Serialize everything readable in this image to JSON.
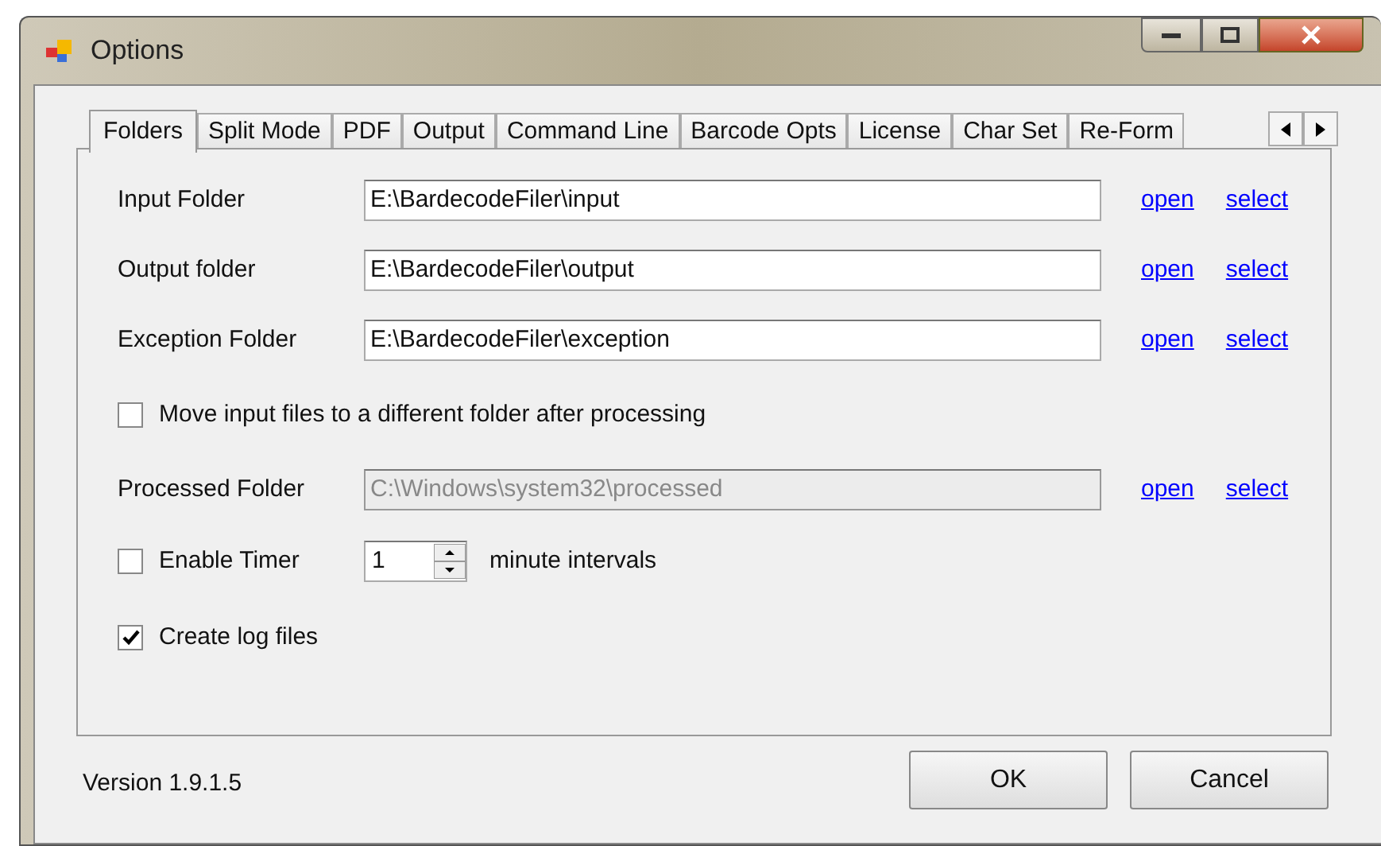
{
  "window": {
    "title": "Options"
  },
  "tabs": [
    {
      "label": "Folders",
      "selected": true
    },
    {
      "label": "Split Mode",
      "selected": false
    },
    {
      "label": "PDF",
      "selected": false
    },
    {
      "label": "Output",
      "selected": false
    },
    {
      "label": "Command Line",
      "selected": false
    },
    {
      "label": "Barcode Opts",
      "selected": false
    },
    {
      "label": "License",
      "selected": false
    },
    {
      "label": "Char Set",
      "selected": false
    },
    {
      "label": "Re-Form",
      "selected": false
    }
  ],
  "rows": [
    {
      "kind": "folder",
      "label": "Input Folder",
      "value": "E:\\BardecodeFiler\\input",
      "disabled": false,
      "links": [
        "open",
        "select"
      ]
    },
    {
      "kind": "folder",
      "label": "Output folder",
      "value": "E:\\BardecodeFiler\\output",
      "disabled": false,
      "links": [
        "open",
        "select"
      ]
    },
    {
      "kind": "folder",
      "label": "Exception Folder",
      "value": "E:\\BardecodeFiler\\exception",
      "disabled": false,
      "links": [
        "open",
        "select"
      ]
    },
    {
      "kind": "checkbox",
      "label": "Move input files to a different folder after processing",
      "checked": false
    },
    {
      "kind": "folder",
      "label": "Processed Folder",
      "value": "C:\\Windows\\system32\\processed",
      "disabled": true,
      "links": [
        "open",
        "select"
      ]
    },
    {
      "kind": "timer",
      "label": "Enable Timer",
      "checked": false,
      "value": "1",
      "suffix": "minute intervals"
    },
    {
      "kind": "checkbox",
      "label": "Create log files",
      "checked": true
    }
  ],
  "footer": {
    "version": "Version 1.9.1.5",
    "buttons": [
      "OK",
      "Cancel"
    ]
  }
}
